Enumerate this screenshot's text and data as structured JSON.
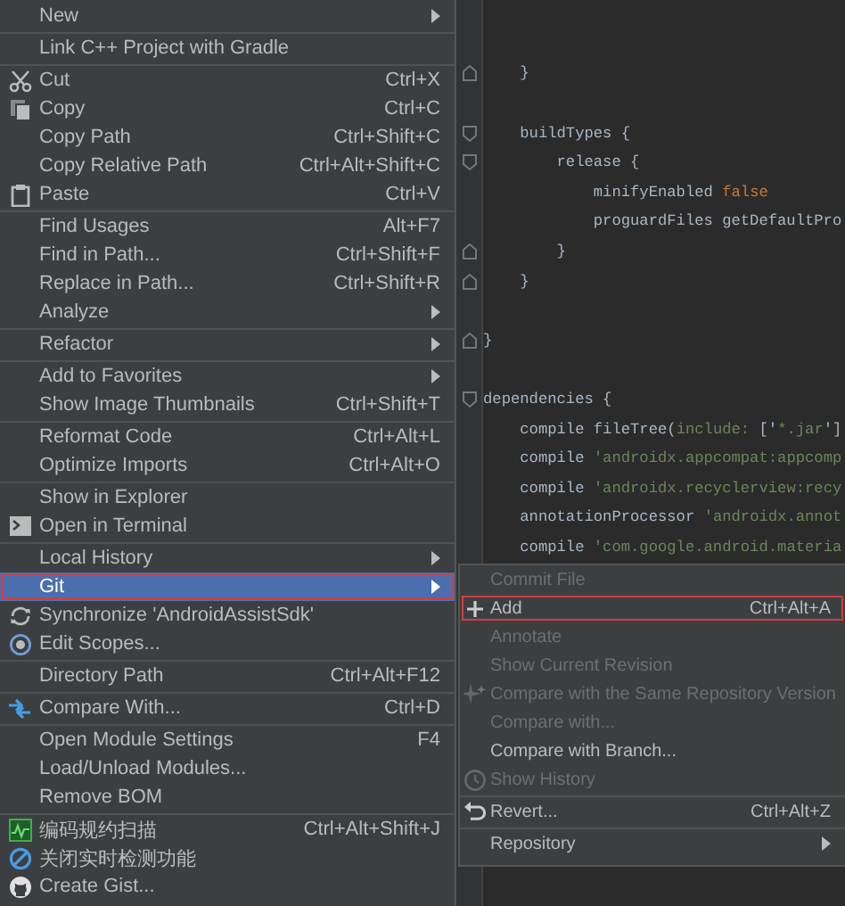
{
  "context_menu": {
    "items": [
      {
        "kind": "item",
        "label": "New",
        "submenu": true,
        "selected": false,
        "outlined": false
      },
      {
        "kind": "separator"
      },
      {
        "kind": "item",
        "label": "Link C++ Project with Gradle",
        "submenu": false,
        "selected": false,
        "outlined": false
      },
      {
        "kind": "separator"
      },
      {
        "kind": "item",
        "label": "Cut",
        "shortcut": "Ctrl+X",
        "submenu": false,
        "selected": false,
        "outlined": false
      },
      {
        "kind": "item",
        "label": "Copy",
        "shortcut": "Ctrl+C",
        "submenu": false,
        "selected": false,
        "outlined": false
      },
      {
        "kind": "item",
        "label": "Copy Path",
        "shortcut": "Ctrl+Shift+C",
        "submenu": false,
        "selected": false,
        "outlined": false
      },
      {
        "kind": "item",
        "label": "Copy Relative Path",
        "shortcut": "Ctrl+Alt+Shift+C",
        "submenu": false,
        "selected": false,
        "outlined": false
      },
      {
        "kind": "item",
        "label": "Paste",
        "shortcut": "Ctrl+V",
        "submenu": false,
        "selected": false,
        "outlined": false
      },
      {
        "kind": "separator"
      },
      {
        "kind": "item",
        "label": "Find Usages",
        "shortcut": "Alt+F7",
        "submenu": false,
        "selected": false,
        "outlined": false
      },
      {
        "kind": "item",
        "label": "Find in Path...",
        "shortcut": "Ctrl+Shift+F",
        "submenu": false,
        "selected": false,
        "outlined": false
      },
      {
        "kind": "item",
        "label": "Replace in Path...",
        "shortcut": "Ctrl+Shift+R",
        "submenu": false,
        "selected": false,
        "outlined": false
      },
      {
        "kind": "item",
        "label": "Analyze",
        "submenu": true,
        "selected": false,
        "outlined": false
      },
      {
        "kind": "separator"
      },
      {
        "kind": "item",
        "label": "Refactor",
        "submenu": true,
        "selected": false,
        "outlined": false
      },
      {
        "kind": "separator"
      },
      {
        "kind": "item",
        "label": "Add to Favorites",
        "submenu": true,
        "selected": false,
        "outlined": false
      },
      {
        "kind": "item",
        "label": "Show Image Thumbnails",
        "shortcut": "Ctrl+Shift+T",
        "submenu": false,
        "selected": false,
        "outlined": false
      },
      {
        "kind": "separator"
      },
      {
        "kind": "item",
        "label": "Reformat Code",
        "shortcut": "Ctrl+Alt+L",
        "submenu": false,
        "selected": false,
        "outlined": false
      },
      {
        "kind": "item",
        "label": "Optimize Imports",
        "shortcut": "Ctrl+Alt+O",
        "submenu": false,
        "selected": false,
        "outlined": false
      },
      {
        "kind": "separator"
      },
      {
        "kind": "item",
        "label": "Show in Explorer",
        "submenu": false,
        "selected": false,
        "outlined": false
      },
      {
        "kind": "item",
        "label": "Open in Terminal",
        "submenu": false,
        "selected": false,
        "outlined": false
      },
      {
        "kind": "separator"
      },
      {
        "kind": "item",
        "label": "Local History",
        "submenu": true,
        "selected": false,
        "outlined": false
      },
      {
        "kind": "item",
        "label": "Git",
        "submenu": true,
        "selected": true,
        "outlined": true
      },
      {
        "kind": "item",
        "label": "Synchronize 'AndroidAssistSdk'",
        "submenu": false,
        "selected": false,
        "outlined": false
      },
      {
        "kind": "item",
        "label": "Edit Scopes...",
        "submenu": false,
        "selected": false,
        "outlined": false
      },
      {
        "kind": "separator"
      },
      {
        "kind": "item",
        "label": "Directory Path",
        "shortcut": "Ctrl+Alt+F12",
        "submenu": false,
        "selected": false,
        "outlined": false
      },
      {
        "kind": "separator"
      },
      {
        "kind": "item",
        "label": "Compare With...",
        "shortcut": "Ctrl+D",
        "submenu": false,
        "selected": false,
        "outlined": false
      },
      {
        "kind": "separator"
      },
      {
        "kind": "item",
        "label": "Open Module Settings",
        "shortcut": "F4",
        "submenu": false,
        "selected": false,
        "outlined": false
      },
      {
        "kind": "item",
        "label": "Load/Unload Modules...",
        "submenu": false,
        "selected": false,
        "outlined": false
      },
      {
        "kind": "item",
        "label": "Remove BOM",
        "submenu": false,
        "selected": false,
        "outlined": false
      },
      {
        "kind": "separator"
      },
      {
        "kind": "item",
        "label": "编码规约扫描",
        "shortcut": "Ctrl+Alt+Shift+J",
        "submenu": false,
        "selected": false,
        "outlined": false
      },
      {
        "kind": "item",
        "label": "关闭实时检测功能",
        "submenu": false,
        "selected": false,
        "outlined": false
      },
      {
        "kind": "item",
        "label": "Create Gist...",
        "submenu": false,
        "selected": false,
        "outlined": false
      }
    ]
  },
  "editor": {
    "lines": [
      {
        "kind": "blank"
      },
      {
        "kind": "blank"
      },
      {
        "kind": "fold-end",
        "segments": [
          {
            "kind": "plain",
            "text": "    }"
          }
        ]
      },
      {
        "kind": "blank"
      },
      {
        "kind": "fold-start",
        "segments": [
          {
            "kind": "plain",
            "text": "    buildTypes {"
          }
        ]
      },
      {
        "kind": "fold-start",
        "segments": [
          {
            "kind": "plain",
            "text": "        release {"
          }
        ]
      },
      {
        "kind": "code",
        "segments": [
          {
            "kind": "plain",
            "text": "            minifyEnabled "
          },
          {
            "kind": "keyword",
            "text": "false"
          }
        ]
      },
      {
        "kind": "code",
        "segments": [
          {
            "kind": "plain",
            "text": "            proguardFiles getDefaultPro"
          }
        ]
      },
      {
        "kind": "fold-end",
        "segments": [
          {
            "kind": "plain",
            "text": "        }"
          }
        ]
      },
      {
        "kind": "fold-end",
        "segments": [
          {
            "kind": "plain",
            "text": "    }"
          }
        ]
      },
      {
        "kind": "blank"
      },
      {
        "kind": "fold-end",
        "segments": [
          {
            "kind": "plain",
            "text": "}"
          }
        ]
      },
      {
        "kind": "blank"
      },
      {
        "kind": "fold-start",
        "segments": [
          {
            "kind": "plain",
            "text": "dependencies {"
          }
        ]
      },
      {
        "kind": "code",
        "segments": [
          {
            "kind": "plain",
            "text": "    compile fileTree("
          },
          {
            "kind": "string",
            "text": "include: "
          },
          {
            "kind": "plain",
            "text": "['"
          },
          {
            "kind": "string",
            "text": "*.jar"
          },
          {
            "kind": "plain",
            "text": "']"
          }
        ]
      },
      {
        "kind": "code",
        "segments": [
          {
            "kind": "plain",
            "text": "    compile "
          },
          {
            "kind": "string",
            "text": "'androidx.appcompat:appcomp"
          }
        ]
      },
      {
        "kind": "code",
        "segments": [
          {
            "kind": "plain",
            "text": "    compile "
          },
          {
            "kind": "string",
            "text": "'androidx.recyclerview:recy"
          }
        ]
      },
      {
        "kind": "code",
        "segments": [
          {
            "kind": "plain",
            "text": "    annotationProcessor "
          },
          {
            "kind": "string",
            "text": "'androidx.annot"
          }
        ]
      },
      {
        "kind": "code",
        "segments": [
          {
            "kind": "plain",
            "text": "    compile "
          },
          {
            "kind": "string",
            "text": "'com.google.android.materia"
          }
        ]
      }
    ]
  },
  "git_submenu": {
    "items": [
      {
        "kind": "item",
        "label": "Commit File",
        "submenu": false,
        "disabled": true,
        "selected": false,
        "outlined": false
      },
      {
        "kind": "item",
        "label": "Add",
        "shortcut": "Ctrl+Alt+A",
        "submenu": false,
        "disabled": false,
        "selected": false,
        "outlined": true
      },
      {
        "kind": "item",
        "label": "Annotate",
        "submenu": false,
        "disabled": true,
        "selected": false,
        "outlined": false
      },
      {
        "kind": "item",
        "label": "Show Current Revision",
        "submenu": false,
        "disabled": true,
        "selected": false,
        "outlined": false
      },
      {
        "kind": "item",
        "label": "Compare with the Same Repository Version",
        "submenu": false,
        "disabled": true,
        "selected": false,
        "outlined": false
      },
      {
        "kind": "item",
        "label": "Compare with...",
        "submenu": false,
        "disabled": true,
        "selected": false,
        "outlined": false
      },
      {
        "kind": "item",
        "label": "Compare with Branch...",
        "submenu": false,
        "disabled": false,
        "selected": false,
        "outlined": false
      },
      {
        "kind": "item",
        "label": "Show History",
        "submenu": false,
        "disabled": true,
        "selected": false,
        "outlined": false
      },
      {
        "kind": "separator"
      },
      {
        "kind": "item",
        "label": "Revert...",
        "shortcut": "Ctrl+Alt+Z",
        "submenu": false,
        "disabled": false,
        "selected": false,
        "outlined": false
      },
      {
        "kind": "separator"
      },
      {
        "kind": "item",
        "label": "Repository",
        "submenu": true,
        "disabled": false,
        "selected": false,
        "outlined": false
      }
    ]
  }
}
